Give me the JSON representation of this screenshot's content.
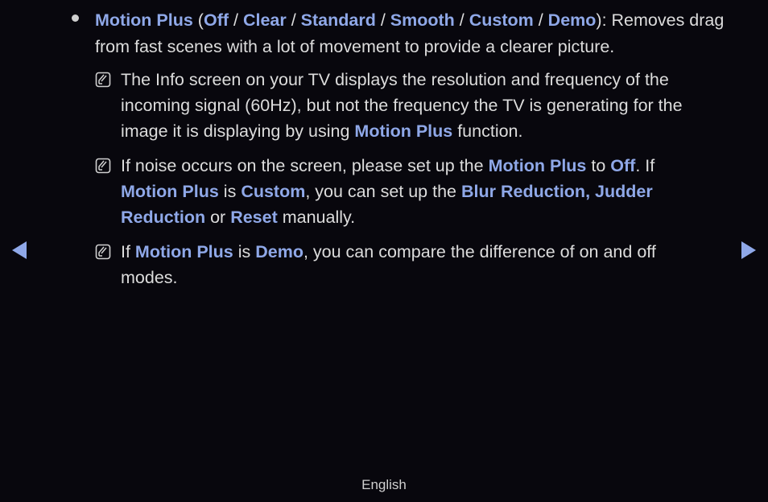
{
  "bullet": {
    "title": "Motion Plus",
    "open_paren": " (",
    "options": [
      "Off",
      "Clear",
      "Standard",
      "Smooth",
      "Custom",
      "Demo"
    ],
    "separator": " / ",
    "close_paren": "): ",
    "description": "Removes drag from fast scenes with a lot of movement to provide a clearer picture."
  },
  "notes": [
    {
      "segments": [
        {
          "text": "The Info screen on your TV displays the resolution and frequency of the incoming signal (60Hz), but not the frequency the TV is generating for the image it is displaying by using ",
          "hl": false
        },
        {
          "text": "Motion Plus",
          "hl": true
        },
        {
          "text": " function.",
          "hl": false
        }
      ]
    },
    {
      "segments": [
        {
          "text": "If noise occurs on the screen, please set up the ",
          "hl": false
        },
        {
          "text": "Motion Plus",
          "hl": true
        },
        {
          "text": " to ",
          "hl": false
        },
        {
          "text": "Off",
          "hl": true
        },
        {
          "text": ". If ",
          "hl": false
        },
        {
          "text": "Motion Plus",
          "hl": true
        },
        {
          "text": " is ",
          "hl": false
        },
        {
          "text": "Custom",
          "hl": true
        },
        {
          "text": ", you can set up the ",
          "hl": false
        },
        {
          "text": "Blur Reduction, Judder Reduction",
          "hl": true
        },
        {
          "text": " or ",
          "hl": false
        },
        {
          "text": "Reset",
          "hl": true
        },
        {
          "text": " manually.",
          "hl": false
        }
      ]
    },
    {
      "segments": [
        {
          "text": "If ",
          "hl": false
        },
        {
          "text": "Motion Plus",
          "hl": true
        },
        {
          "text": " is ",
          "hl": false
        },
        {
          "text": "Demo",
          "hl": true
        },
        {
          "text": ", you can compare the difference of on and off modes.",
          "hl": false
        }
      ]
    }
  ],
  "nav": {
    "prev_icon": "triangle-left",
    "next_icon": "triangle-right"
  },
  "footer": {
    "language": "English"
  },
  "colors": {
    "highlight": "#8fa8e8",
    "background": "#08070d",
    "text": "#dcdcdc"
  }
}
